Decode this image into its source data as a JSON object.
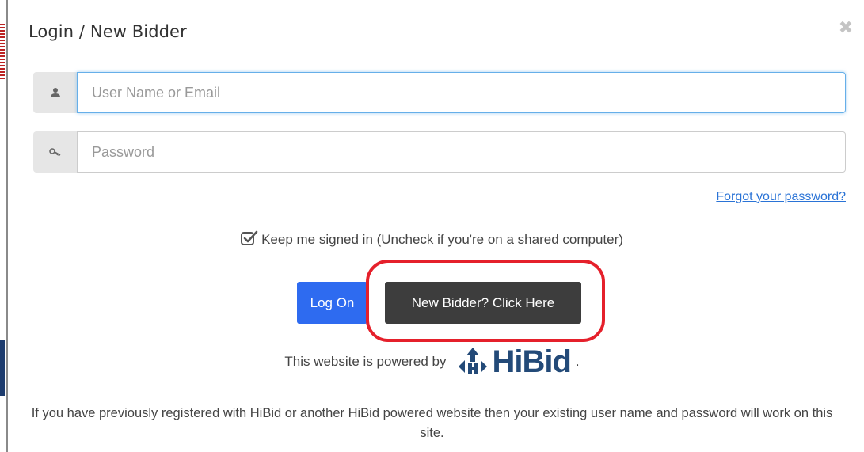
{
  "modal": {
    "title": "Login / New Bidder",
    "close_icon": "close-icon"
  },
  "username": {
    "icon": "user-icon",
    "placeholder": "User Name or Email",
    "value": ""
  },
  "password": {
    "icon": "key-icon",
    "placeholder": "Password",
    "value": ""
  },
  "forgot_password_label": "Forgot your password?",
  "keep_signed_in": {
    "checked": true,
    "label": "Keep me signed in (Uncheck if you're on a shared computer)"
  },
  "buttons": {
    "log_on": "Log On",
    "new_bidder": "New Bidder? Click Here"
  },
  "powered_by": {
    "text": "This website is powered by",
    "logo_text": "HiBid",
    "trailing": "."
  },
  "info_text": "If you have previously registered with HiBid or another HiBid powered website then your existing user name and password will work on this site.",
  "colors": {
    "primary": "#2e6bf0",
    "dark_button": "#3d3d3d",
    "highlight": "#e5202b",
    "logo": "#234a78",
    "link": "#2a73d6"
  }
}
